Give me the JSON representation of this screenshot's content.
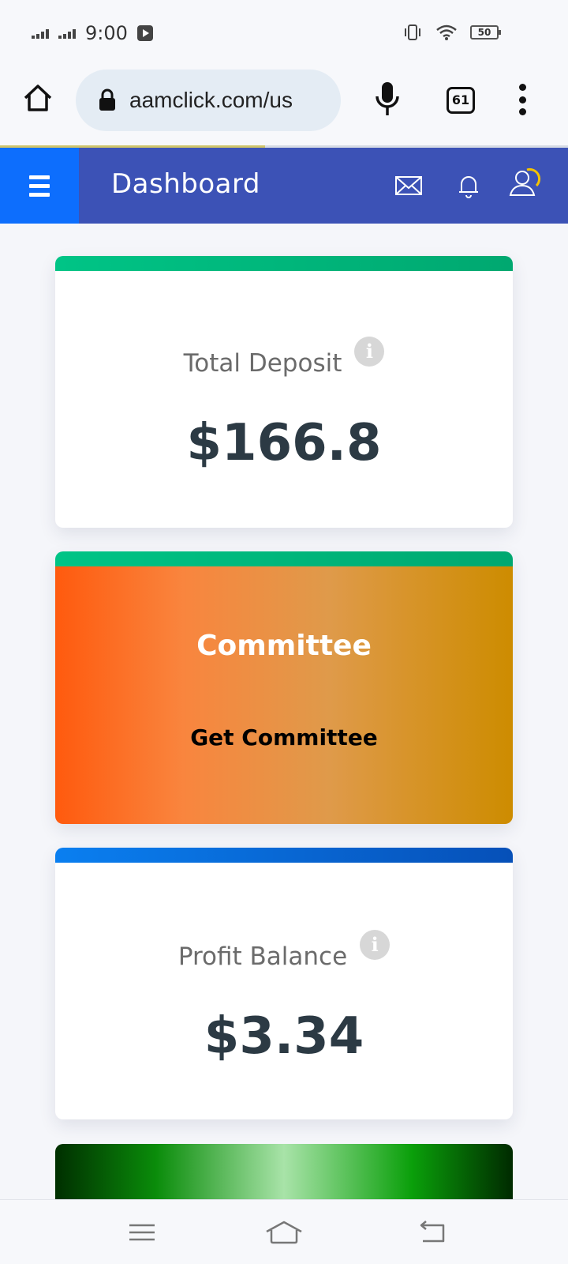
{
  "status_bar": {
    "time": "9:00",
    "battery": "50",
    "icons": [
      "signal-icon",
      "signal-icon",
      "youtube-icon",
      "vibrate-icon",
      "wifi-icon",
      "battery-icon"
    ]
  },
  "browser": {
    "url": "aamclick.com/us",
    "tab_count": "61",
    "icons": [
      "home-icon",
      "lock-icon",
      "mic-icon",
      "tabs-icon",
      "more-icon"
    ]
  },
  "header": {
    "title": "Dashboard",
    "colors": {
      "bar": "#3c52b6",
      "menu": "#0d6efd"
    },
    "icons": [
      "menu-icon",
      "mail-icon",
      "bell-icon",
      "user-icon"
    ]
  },
  "cards": {
    "total_deposit": {
      "label": "Total Deposit",
      "value": "$166.8",
      "accent": "#00b67a"
    },
    "committee": {
      "title": "Committee",
      "link": "Get Committee",
      "accent": "#00b67a"
    },
    "profit_balance": {
      "label": "Profit Balance",
      "value": "$3.34",
      "accent": "#0b63d6"
    }
  },
  "nav": {
    "icons": [
      "recent-apps-icon",
      "home-nav-icon",
      "back-icon"
    ]
  }
}
